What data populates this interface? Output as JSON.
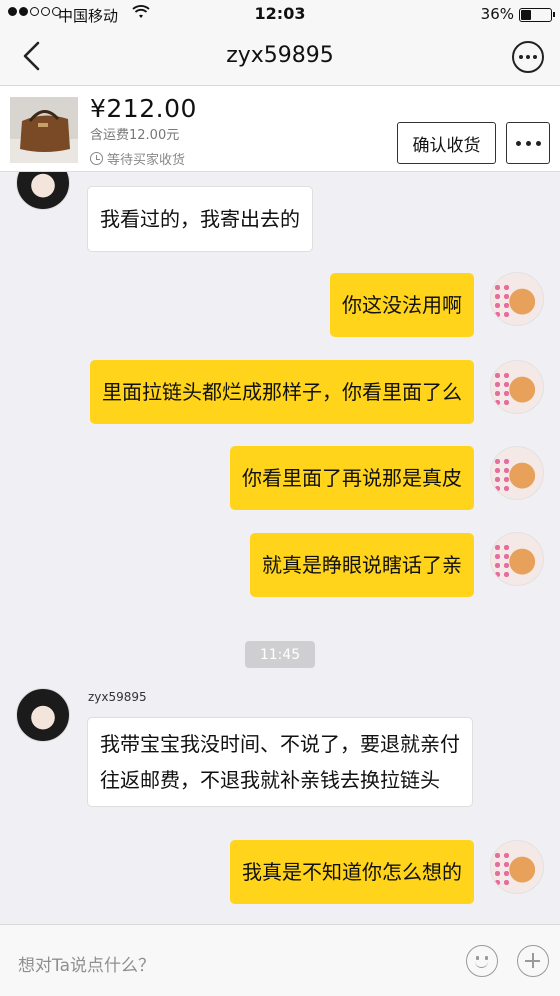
{
  "status_bar": {
    "carrier": "中国移动",
    "time": "12:03",
    "battery_percent": "36%",
    "battery_level": 0.36,
    "signal_bars_filled": 2,
    "signal_bars_total": 5
  },
  "nav": {
    "back_icon": "chevron-left-icon",
    "title": "zyx59895",
    "more_icon": "more-circle-icon"
  },
  "product": {
    "price": "¥212.00",
    "shipping": "含运费12.00元",
    "status": "等待买家收货",
    "confirm_label": "确认收货",
    "more_icon": "ellipsis-icon"
  },
  "messages": [
    {
      "side": "in",
      "text": "我看过的，我寄出去的"
    },
    {
      "side": "out",
      "text": "你这没法用啊"
    },
    {
      "side": "out",
      "text": "里面拉链头都烂成那样子，你看里面了么"
    },
    {
      "side": "out",
      "text": "你看里面了再说那是真皮"
    },
    {
      "side": "out",
      "text": "就真是睁眼说瞎话了亲"
    },
    {
      "side": "in",
      "sender": "zyx59895",
      "lines": [
        "我带宝宝我没时间、不说了，要退就亲付",
        "往返邮费，不退我就补亲钱去换拉链头"
      ]
    },
    {
      "side": "out",
      "text": "我真是不知道你怎么想的"
    }
  ],
  "timestamp": "11:45",
  "input": {
    "placeholder": "想对Ta说点什么？",
    "emoji_icon": "emoji-icon",
    "plus_icon": "plus-icon"
  },
  "colors": {
    "outgoing_bubble": "#ffd41a",
    "incoming_bubble": "#ffffff",
    "background": "#efeff4"
  }
}
